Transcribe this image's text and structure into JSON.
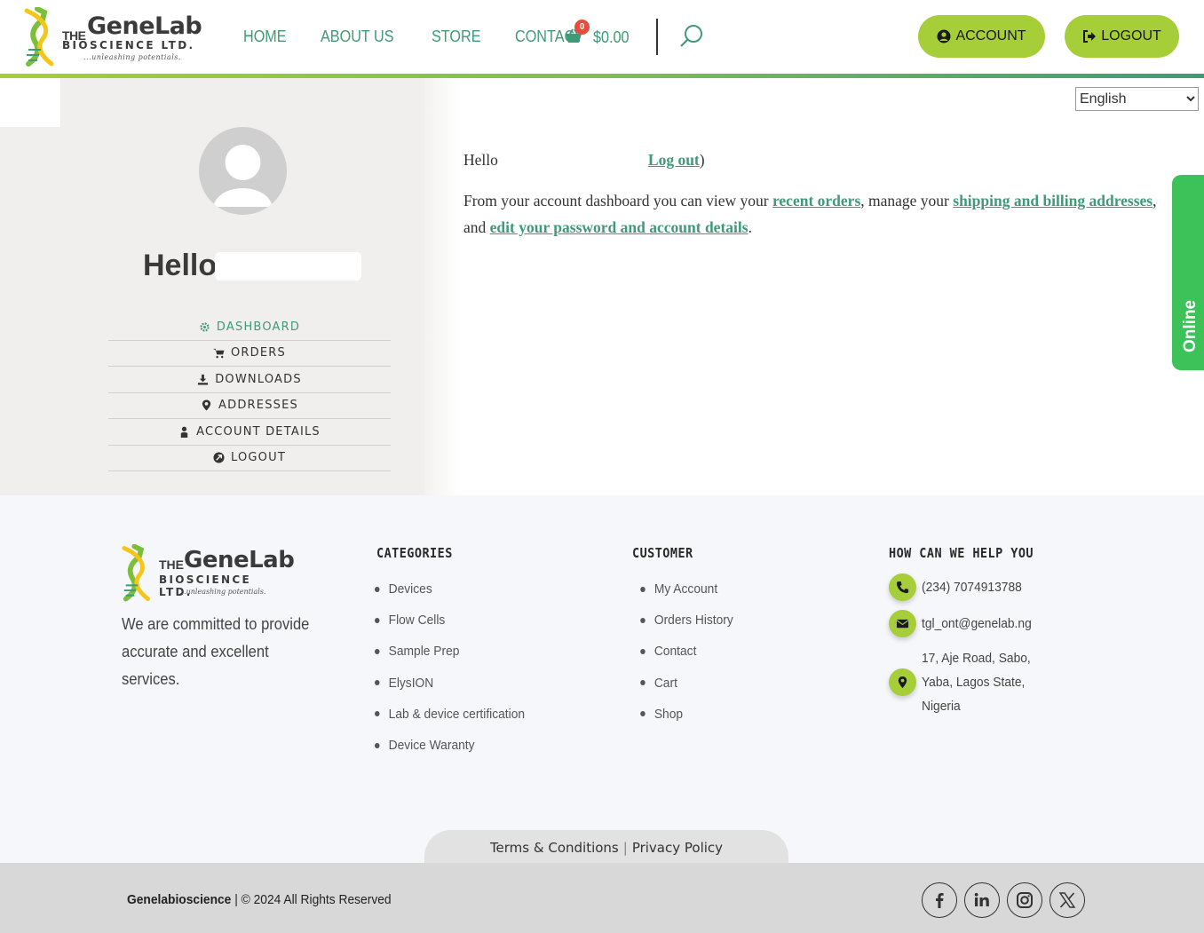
{
  "brand": {
    "the": "THE",
    "name": "GeneLab",
    "sub": "BIOSCIENCE LTD.",
    "tagline": "...unleashing potentials."
  },
  "nav": {
    "items": [
      "HOME",
      "ABOUT US",
      "STORE",
      "CONTACT"
    ],
    "cart_count": "0",
    "cart_total": "$0.00"
  },
  "header_buttons": {
    "account": "ACCOUNT",
    "logout": "LOGOUT"
  },
  "language": {
    "selected": "English"
  },
  "sidebar": {
    "greeting": "Hello",
    "menu": [
      {
        "label": "DASHBOARD",
        "icon": "gear-icon",
        "active": true
      },
      {
        "label": "ORDERS",
        "icon": "cart-icon",
        "active": false
      },
      {
        "label": "DOWNLOADS",
        "icon": "download-icon",
        "active": false
      },
      {
        "label": "ADDRESSES",
        "icon": "map-pin-icon",
        "active": false
      },
      {
        "label": "ACCOUNT DETAILS",
        "icon": "user-icon",
        "active": false
      },
      {
        "label": "LOGOUT",
        "icon": "logout-icon",
        "active": false
      }
    ]
  },
  "dashboard": {
    "hello": "Hello",
    "logout_link": "Log out",
    "close_paren": ")",
    "intro_1": "From your account dashboard you can view your ",
    "link_orders": "recent orders",
    "intro_2": ", manage your ",
    "link_addresses": "shipping and billing addresses",
    "intro_3": ", and ",
    "link_account": "edit your password and account details",
    "intro_4": "."
  },
  "online_tab": "Online",
  "footer": {
    "tagline": "We are committed to provide accurate and excellent services.",
    "categories": {
      "title": "CATEGORIES",
      "items": [
        "Devices",
        "Flow Cells",
        "Sample Prep",
        "ElysION",
        "Lab & device certification",
        "Device Waranty"
      ]
    },
    "customer": {
      "title": "CUSTOMER",
      "items": [
        "My Account",
        "Orders History",
        "Contact",
        "Cart",
        "Shop"
      ]
    },
    "help": {
      "title": "HOW CAN WE HELP YOU",
      "phone": "(234) 7074913788",
      "email": "tgl_ont@genelab.ng",
      "address": "17, Aje Road, Sabo, Yaba, Lagos State, Nigeria"
    },
    "legal": {
      "terms": "Terms & Conditions",
      "separator": "|",
      "privacy": "Privacy Policy"
    },
    "copyright_brand": "Genelabioscience",
    "copyright_rest": " | © 2024 All Rights Reserved"
  },
  "colors": {
    "accent_green": "#3f9a77",
    "lime": "#a6ce39",
    "online_green": "#3dc25a",
    "badge_red": "#e74c3c"
  }
}
